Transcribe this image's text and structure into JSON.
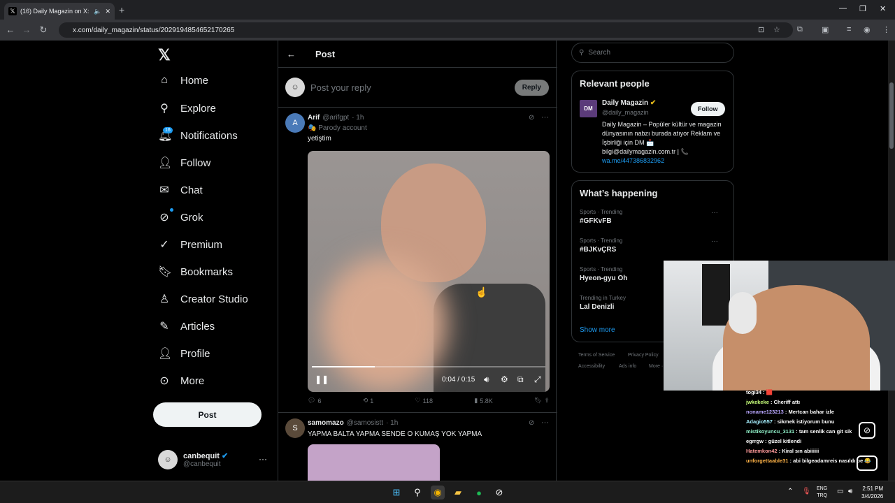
{
  "browser": {
    "tab_title": "(16) Daily Magazin on X: \"M",
    "url": "x.com/daily_magazin/status/2029194854652170265"
  },
  "sidebar": {
    "items": [
      {
        "label": "Home",
        "icon": "home-icon"
      },
      {
        "label": "Explore",
        "icon": "search-icon"
      },
      {
        "label": "Notifications",
        "icon": "bell-icon"
      },
      {
        "label": "Follow",
        "icon": "person-add-icon"
      },
      {
        "label": "Chat",
        "icon": "mail-icon"
      },
      {
        "label": "Grok",
        "icon": "grok-icon"
      },
      {
        "label": "Premium",
        "icon": "premium-icon"
      },
      {
        "label": "Bookmarks",
        "icon": "bookmark-icon"
      },
      {
        "label": "Creator Studio",
        "icon": "creator-studio-icon"
      },
      {
        "label": "Articles",
        "icon": "article-icon"
      },
      {
        "label": "Profile",
        "icon": "person-icon"
      },
      {
        "label": "More",
        "icon": "more-circle-icon"
      }
    ],
    "notif_count": "16",
    "post_label": "Post",
    "user": {
      "name": "canbequit",
      "handle": "@canbequit"
    }
  },
  "main": {
    "header_title": "Post",
    "reply_placeholder": "Post your reply",
    "reply_button": "Reply",
    "tweet1": {
      "name": "Arif",
      "handle": "@arifgpt",
      "time": "· 1h",
      "badge": "Parody account",
      "text": "yetiştim",
      "video": {
        "time": "0:04 / 0:15",
        "progress": 0.27
      },
      "actions": {
        "replies": "6",
        "reposts": "1",
        "likes": "118",
        "views": "5.8K"
      }
    },
    "tweet2": {
      "name": "samomazo",
      "handle": "@samosistt",
      "time": "· 1h",
      "text": "YAPMA BALTA YAPMA SENDE O KUMAŞ YOK YAPMA"
    }
  },
  "right": {
    "search_placeholder": "Search",
    "relevant_title": "Relevant people",
    "person": {
      "logo": "DM",
      "name": "Daily Magazin",
      "handle": "@daily_magazin",
      "follow": "Follow",
      "bio": "Daily Magazin – Popüler kültür ve magazin dünyasının nabzı burada atıyor Reklam ve İşbirliği için DM 📩 bilgi@dailymagazin.com.tr | 📞",
      "link": "wa.me/447386832962"
    },
    "happening_title": "What’s happening",
    "trends": [
      {
        "category": "Sports · Trending",
        "name": "#GFKvFB"
      },
      {
        "category": "Sports · Trending",
        "name": "#BJKvÇRS"
      },
      {
        "category": "Sports · Trending",
        "name": "Hyeon-gyu Oh"
      },
      {
        "category": "Trending in Turkey",
        "name": "Lal Denizli"
      }
    ],
    "show_more": "Show more",
    "footer": [
      "Terms of Service",
      "Privacy Policy",
      "Accessibility",
      "Ads info",
      "More ···"
    ]
  },
  "chat": [
    {
      "user": "togi34",
      "msg": "🟥",
      "color": "#ffffff"
    },
    {
      "user": "jwkekeke",
      "msg": "Cheriff attı",
      "color": "#c8ff7a"
    },
    {
      "user": "noname123213",
      "msg": "Mertcan bahar izle",
      "color": "#b9a7ff"
    },
    {
      "user": "Adagio557",
      "msg": "sikmek istiyorum bunu",
      "color": "#a6f0ff"
    },
    {
      "user": "mistikoyuncu_3131",
      "msg": "tam senlik can git sik",
      "color": "#8ff0c8"
    },
    {
      "user": "egrrgw",
      "msg": "güzel kitlendi",
      "color": "#ffffff"
    },
    {
      "user": "Hatemkon42",
      "msg": "Kiral sın abiiiiii",
      "color": "#ff9a9a"
    },
    {
      "user": "unforgettaable31",
      "msg": "abi bilgeadamreis nasıldı be 😂",
      "color": "#ffb347"
    }
  ],
  "taskbar": {
    "lang": "ENG\nTRQ",
    "time": "2:51 PM",
    "date": "3/4/2026"
  }
}
